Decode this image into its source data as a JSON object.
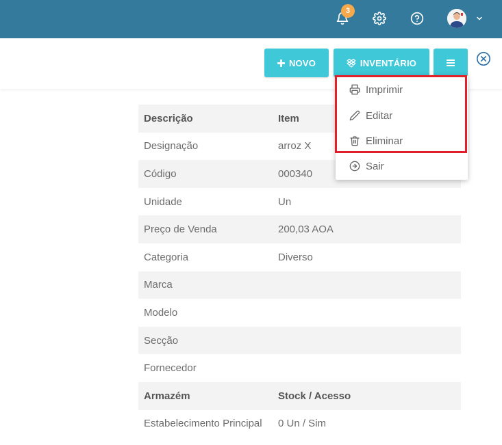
{
  "header": {
    "notification_count": "3",
    "icons": [
      "bell-icon",
      "gear-icon",
      "help-icon",
      "avatar",
      "chevron-down-icon"
    ],
    "bg_color": "#337a9c"
  },
  "toolbar": {
    "new_label": "NOVO",
    "inventory_label": "INVENTÁRIO",
    "accent_color": "#3ec8d8"
  },
  "menu": {
    "items": [
      {
        "label": "Imprimir",
        "icon": "printer-icon"
      },
      {
        "label": "Editar",
        "icon": "pencil-icon"
      },
      {
        "label": "Eliminar",
        "icon": "trash-icon"
      },
      {
        "label": "Sair",
        "icon": "exit-icon"
      }
    ]
  },
  "details": {
    "header": {
      "col1": "Descrição",
      "col2": "Item"
    },
    "rows": [
      {
        "label": "Designação",
        "value": "arroz X"
      },
      {
        "label": "Código",
        "value": "000340"
      },
      {
        "label": "Unidade",
        "value": "Un"
      },
      {
        "label": "Preço de Venda",
        "value": "200,03 AOA"
      },
      {
        "label": "Categoria",
        "value": "Diverso"
      },
      {
        "label": "Marca",
        "value": ""
      },
      {
        "label": "Modelo",
        "value": ""
      },
      {
        "label": "Secção",
        "value": ""
      },
      {
        "label": "Fornecedor",
        "value": ""
      }
    ],
    "stock_header": {
      "col1": "Armazém",
      "col2": "Stock / Acesso"
    },
    "stock_rows": [
      {
        "label": "Estabelecimento Principal",
        "value": "0 Un / Sim"
      }
    ]
  }
}
